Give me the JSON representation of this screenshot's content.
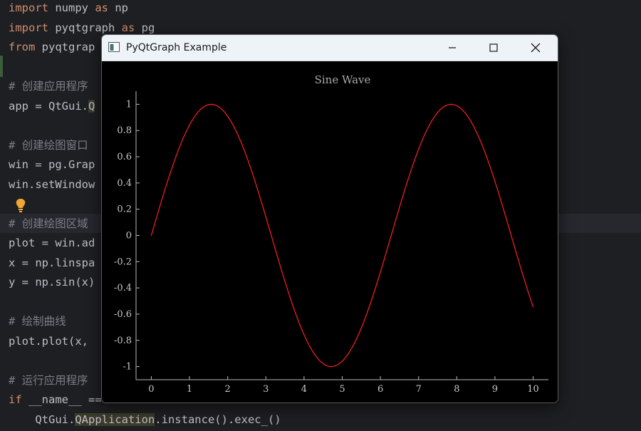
{
  "editor": {
    "lines": [
      [
        {
          "t": "import",
          "c": "kw"
        },
        {
          "t": " numpy ",
          "c": "nm"
        },
        {
          "t": "as",
          "c": "kw"
        },
        {
          "t": " np",
          "c": "nm"
        }
      ],
      [
        {
          "t": "import",
          "c": "kw"
        },
        {
          "t": " pyqtgraph ",
          "c": "nm"
        },
        {
          "t": "as",
          "c": "kw"
        },
        {
          "t": " pg",
          "c": "nm"
        }
      ],
      [
        {
          "t": "from",
          "c": "kw"
        },
        {
          "t": " pyqtgrap",
          "c": "nm"
        }
      ],
      [],
      [
        {
          "t": "# 创建应用程序",
          "c": "cm"
        }
      ],
      [
        {
          "t": "app = QtGui.",
          "c": "nm"
        },
        {
          "t": "Q",
          "c": "hlcls"
        }
      ],
      [],
      [
        {
          "t": "# 创建绘图窗口",
          "c": "cm"
        }
      ],
      [
        {
          "t": "win = pg.Grap",
          "c": "nm"
        }
      ],
      [
        {
          "t": "win.setWindow",
          "c": "nm"
        }
      ],
      [],
      [
        {
          "t": "# 创建绘图区域",
          "c": "cm"
        }
      ],
      [
        {
          "t": "plot = win.ad",
          "c": "nm"
        }
      ],
      [
        {
          "t": "x = np.linspa",
          "c": "nm"
        }
      ],
      [
        {
          "t": "y = np.sin(x)",
          "c": "nm"
        }
      ],
      [],
      [
        {
          "t": "# 绘制曲线",
          "c": "cm"
        }
      ],
      [
        {
          "t": "plot.plot(x,",
          "c": "nm"
        }
      ],
      [],
      [
        {
          "t": "# 运行应用程序",
          "c": "cm"
        }
      ],
      [
        {
          "t": "if",
          "c": "kw"
        },
        {
          "t": " __name__ ",
          "c": "nm"
        },
        {
          "t": "==",
          "c": "nm"
        }
      ],
      [
        {
          "t": "    QtGui.",
          "c": "nm"
        },
        {
          "t": "QApplication",
          "c": "hlcls"
        },
        {
          "t": ".instance().exec_()",
          "c": "nm"
        }
      ]
    ]
  },
  "window": {
    "title": "PyQtGraph Example",
    "minimize_glyph": "—",
    "close_glyph": "✕"
  },
  "chart_data": {
    "type": "line",
    "title": "Sine Wave",
    "xlabel": "",
    "ylabel": "",
    "xlim": [
      -0.4,
      10.4
    ],
    "ylim": [
      -1.1,
      1.1
    ],
    "x_ticks": [
      "0",
      "1",
      "2",
      "3",
      "4",
      "5",
      "6",
      "7",
      "8",
      "9",
      "10"
    ],
    "y_ticks": [
      "1",
      "0.8",
      "0.6",
      "0.4",
      "0.2",
      "0",
      "-0.2",
      "-0.4",
      "-0.6",
      "-0.8",
      "-1"
    ],
    "series": [
      {
        "color": "#ff2020",
        "function": "sin(x)",
        "x": [
          0,
          0.5,
          1,
          1.5708,
          2,
          2.5,
          3,
          3.5,
          4,
          4.7124,
          5,
          5.5,
          6,
          6.5,
          7,
          7.5,
          7.854,
          8.5,
          9,
          9.5,
          10
        ],
        "y": [
          0,
          0.479,
          0.841,
          1,
          0.909,
          0.598,
          0.141,
          -0.351,
          -0.757,
          -1,
          -0.959,
          -0.706,
          -0.279,
          0.215,
          0.657,
          0.938,
          1,
          0.798,
          0.412,
          -0.075,
          -0.544
        ]
      }
    ],
    "grid": false
  }
}
